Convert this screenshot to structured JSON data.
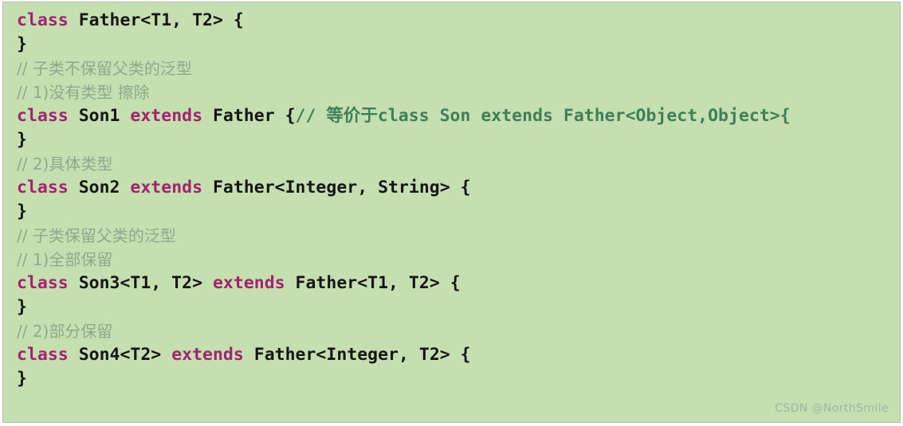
{
  "editor": {
    "language": "java",
    "background_color": "#c6dfb0",
    "border_color": "#b9b9b9",
    "keyword_color": "#a0246e",
    "identifier_color": "#151515",
    "comment_color": "#8aab8a",
    "inline_comment_color": "#3d7f58",
    "watermark": "CSDN @NorthSmile",
    "lines": [
      {
        "id": "line-1",
        "kind": "code",
        "text": "class Father<T1, T2> {",
        "tokens": [
          {
            "type": "kw",
            "text": "class"
          },
          {
            "type": "punct",
            "text": " "
          },
          {
            "type": "ident",
            "text": "Father<T1, T2> {"
          }
        ]
      },
      {
        "id": "line-2",
        "kind": "code",
        "text": "}",
        "tokens": [
          {
            "type": "punct",
            "text": "}"
          }
        ]
      },
      {
        "id": "line-3",
        "kind": "comment",
        "text": "// 子类不保留父类的泛型",
        "tokens": [
          {
            "type": "comment",
            "text": "// 子类不保留父类的泛型"
          }
        ]
      },
      {
        "id": "line-4",
        "kind": "comment",
        "text": "// 1)没有类型 擦除",
        "tokens": [
          {
            "type": "comment",
            "text": "// 1)没有类型 擦除"
          }
        ]
      },
      {
        "id": "line-5",
        "kind": "code",
        "text": "class Son1 extends Father {// 等价于class Son extends Father<Object,Object>{",
        "tokens": [
          {
            "type": "kw",
            "text": "class"
          },
          {
            "type": "punct",
            "text": " "
          },
          {
            "type": "ident",
            "text": "Son1"
          },
          {
            "type": "punct",
            "text": " "
          },
          {
            "type": "kw",
            "text": "extends"
          },
          {
            "type": "punct",
            "text": " "
          },
          {
            "type": "ident",
            "text": "Father {"
          },
          {
            "type": "comment-inline",
            "text": "// "
          },
          {
            "type": "comment-inline-cjk",
            "text": "等价于"
          },
          {
            "type": "comment-inline",
            "text": "class Son extends Father<Object,Object>{"
          }
        ]
      },
      {
        "id": "line-6",
        "kind": "code",
        "text": "}",
        "tokens": [
          {
            "type": "punct",
            "text": "}"
          }
        ]
      },
      {
        "id": "line-7",
        "kind": "comment",
        "text": "// 2)具体类型",
        "tokens": [
          {
            "type": "comment",
            "text": "// 2)具体类型"
          }
        ]
      },
      {
        "id": "line-8",
        "kind": "code",
        "text": "class Son2 extends Father<Integer, String> {",
        "tokens": [
          {
            "type": "kw",
            "text": "class"
          },
          {
            "type": "punct",
            "text": " "
          },
          {
            "type": "ident",
            "text": "Son2"
          },
          {
            "type": "punct",
            "text": " "
          },
          {
            "type": "kw",
            "text": "extends"
          },
          {
            "type": "punct",
            "text": " "
          },
          {
            "type": "ident",
            "text": "Father<Integer, String> {"
          }
        ]
      },
      {
        "id": "line-9",
        "kind": "code",
        "text": "}",
        "tokens": [
          {
            "type": "punct",
            "text": "}"
          }
        ]
      },
      {
        "id": "line-10",
        "kind": "comment",
        "text": "// 子类保留父类的泛型",
        "tokens": [
          {
            "type": "comment",
            "text": "// 子类保留父类的泛型"
          }
        ]
      },
      {
        "id": "line-11",
        "kind": "comment",
        "text": "// 1)全部保留",
        "tokens": [
          {
            "type": "comment",
            "text": "// 1)全部保留"
          }
        ]
      },
      {
        "id": "line-12",
        "kind": "code",
        "text": "class Son3<T1, T2> extends Father<T1, T2> {",
        "tokens": [
          {
            "type": "kw",
            "text": "class"
          },
          {
            "type": "punct",
            "text": " "
          },
          {
            "type": "ident",
            "text": "Son3<T1, T2>"
          },
          {
            "type": "punct",
            "text": " "
          },
          {
            "type": "kw",
            "text": "extends"
          },
          {
            "type": "punct",
            "text": " "
          },
          {
            "type": "ident",
            "text": "Father<T1, T2> {"
          }
        ]
      },
      {
        "id": "line-13",
        "kind": "code",
        "text": "}",
        "tokens": [
          {
            "type": "punct",
            "text": "}"
          }
        ]
      },
      {
        "id": "line-14",
        "kind": "comment",
        "text": "// 2)部分保留",
        "tokens": [
          {
            "type": "comment",
            "text": "// 2)部分保留"
          }
        ]
      },
      {
        "id": "line-15",
        "kind": "code",
        "text": "class Son4<T2> extends Father<Integer, T2> {",
        "tokens": [
          {
            "type": "kw",
            "text": "class"
          },
          {
            "type": "punct",
            "text": " "
          },
          {
            "type": "ident",
            "text": "Son4<T2>"
          },
          {
            "type": "punct",
            "text": " "
          },
          {
            "type": "kw",
            "text": "extends"
          },
          {
            "type": "punct",
            "text": " "
          },
          {
            "type": "ident",
            "text": "Father<Integer, T2> {"
          }
        ]
      },
      {
        "id": "line-16",
        "kind": "code",
        "text": "}",
        "tokens": [
          {
            "type": "punct",
            "text": "}"
          }
        ]
      }
    ]
  }
}
